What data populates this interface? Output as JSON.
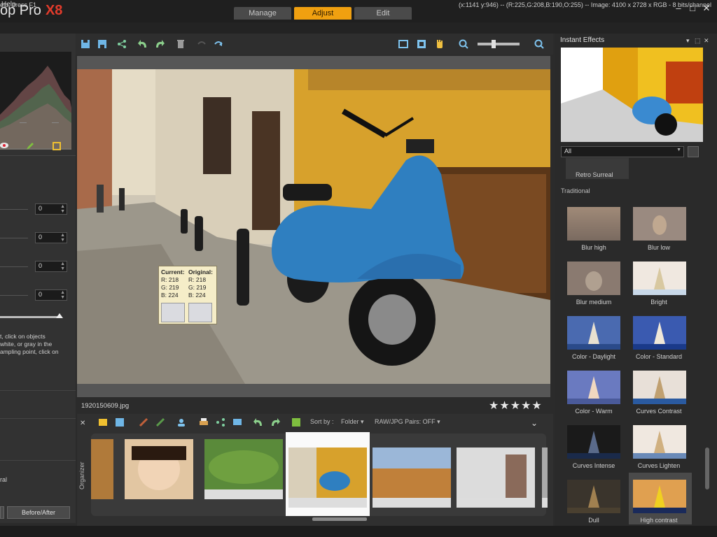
{
  "title": {
    "app_name": "op Pro",
    "version": "X8"
  },
  "mode_tabs": [
    {
      "label": "Manage",
      "active": false
    },
    {
      "label": "Adjust",
      "active": true
    },
    {
      "label": "Edit",
      "active": false
    }
  ],
  "window_controls": {
    "minimize": "‒",
    "maximize": "□",
    "close": "✕"
  },
  "menu": {
    "help": "Help"
  },
  "left_panel": {
    "spin_values": [
      "0",
      "0",
      "0",
      "0"
    ],
    "hint_lines": [
      "t, click on objects",
      "white, or gray in the",
      "ampling point, click on"
    ],
    "bottom_label": "ral",
    "before_after": "Before/After"
  },
  "color_picker": {
    "current_label": "Current:",
    "original_label": "Original:",
    "current": {
      "r": "R: 218",
      "g": "G: 219",
      "b": "B: 224"
    },
    "original": {
      "r": "R: 218",
      "g": "G: 219",
      "b": "B: 224"
    }
  },
  "viewer": {
    "filename": "1920150609.jpg",
    "stars": "★★★★★"
  },
  "organizer": {
    "label": "Organizer",
    "sort_label": "Sort by :",
    "sort_value": "Folder ▾",
    "raw_pairs": "RAW/JPG Pairs: OFF ▾"
  },
  "status": {
    "left": "elp, press F1",
    "right": "(x:1141 y:946) -- (R:225,G:208,B:190,O:255) -- Image: 4100 x 2728 x RGB - 8 bits/channel"
  },
  "instant_effects": {
    "title": "Instant Effects",
    "filter": "All",
    "retro_label": "Retro Surreal",
    "section": "Traditional",
    "effects": [
      {
        "label": "Blur high"
      },
      {
        "label": "Blur low"
      },
      {
        "label": "Blur medium"
      },
      {
        "label": "Bright"
      },
      {
        "label": "Color - Daylight"
      },
      {
        "label": "Color - Standard"
      },
      {
        "label": "Color - Warm"
      },
      {
        "label": "Curves Contrast"
      },
      {
        "label": "Curves Intense"
      },
      {
        "label": "Curves Lighten"
      },
      {
        "label": "Dull"
      },
      {
        "label": "High contrast"
      }
    ]
  },
  "colors": {
    "accent": "#f0a010",
    "brand_x8": "#e23b2b",
    "icon_blue": "#7ec3ee"
  }
}
